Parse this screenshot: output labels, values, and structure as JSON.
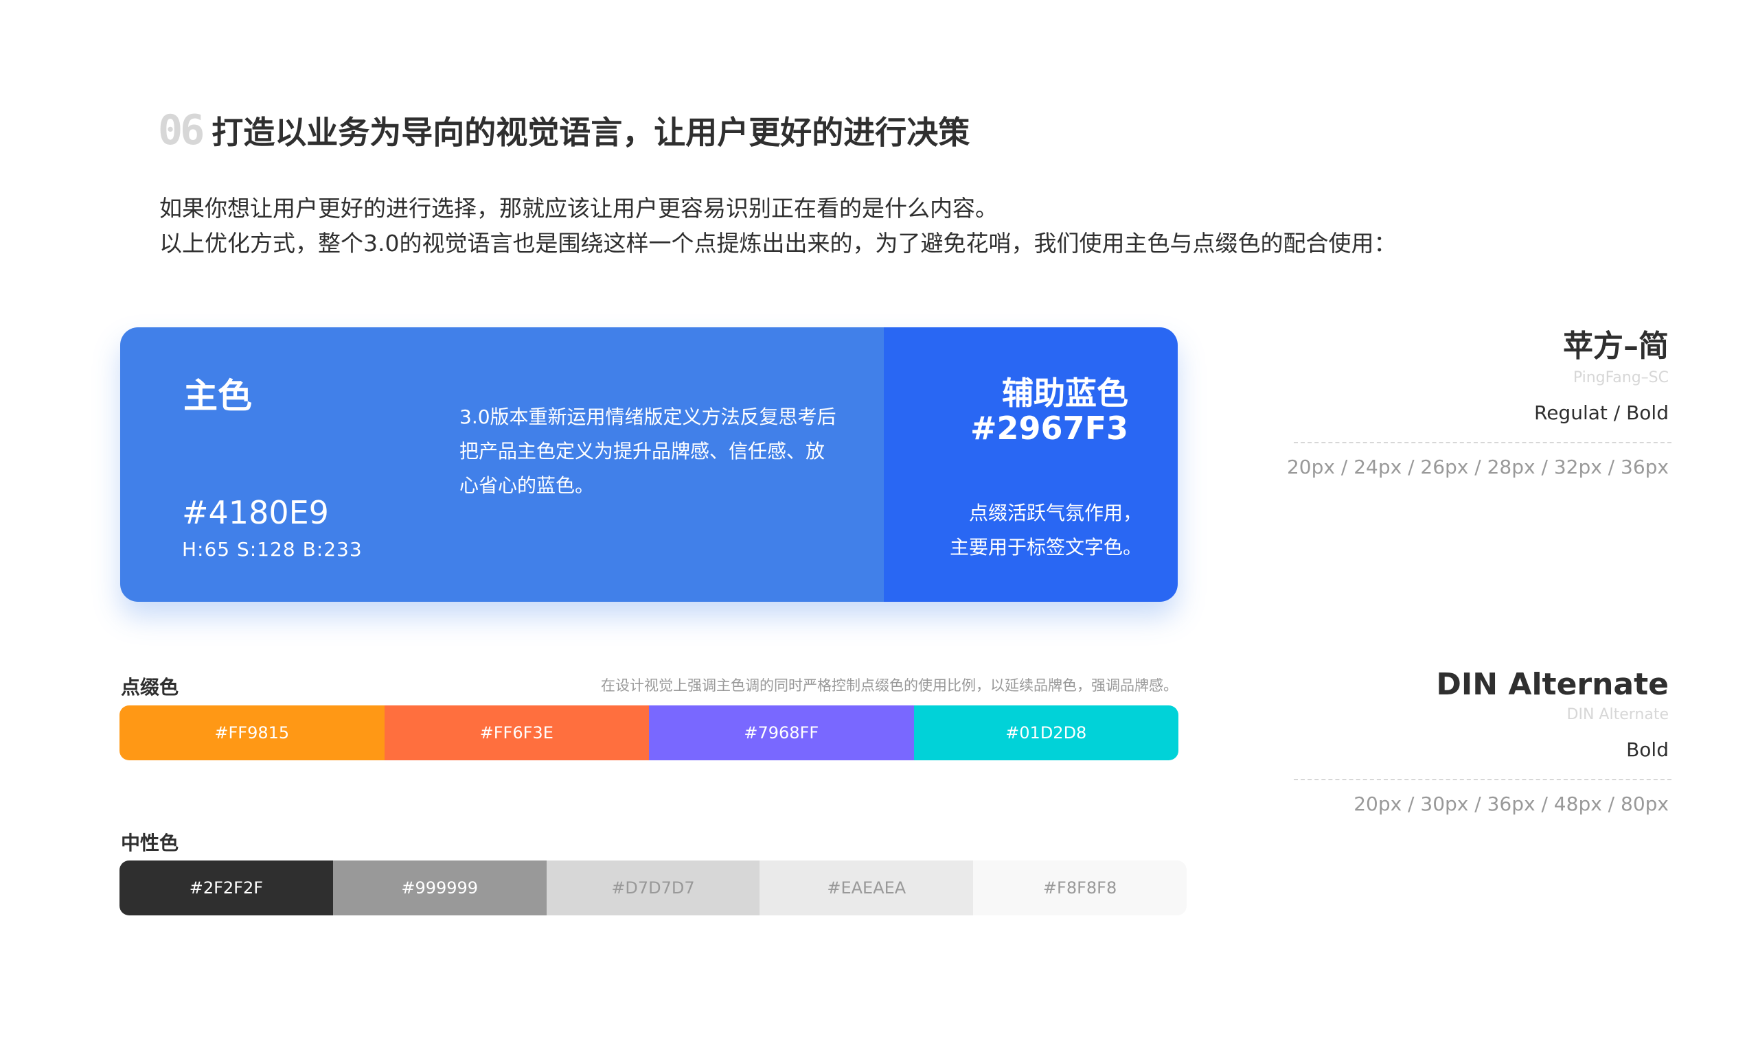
{
  "heading": {
    "number": "06",
    "title": "打造以业务为导向的视觉语言，让用户更好的进行决策"
  },
  "intro": {
    "line1": "如果你想让用户更好的进行选择，那就应该让用户更容易识别正在看的是什么内容。",
    "line2": "以上优化方式，整个3.0的视觉语言也是围绕这样一个点提炼出出来的，为了避免花哨，我们使用主色与点缀色的配合使用："
  },
  "primary": {
    "title": "主色",
    "desc_lines": [
      "3.0版本重新运用情绪版定义方法反复思考后",
      "把产品主色定义为提升品牌感、信任感、放",
      "心省心的蓝色。"
    ],
    "hex": "#4180E9",
    "hsb": "H:65  S:128  B:233",
    "color": "#4180E9"
  },
  "accent": {
    "title": "辅助蓝色",
    "hex": "#2967F3",
    "desc_lines": [
      "点缀活跃气氛作用，",
      "主要用于标签文字色。"
    ],
    "color": "#2967F3"
  },
  "accent_palette": {
    "label": "点缀色",
    "note": "在设计视觉上强调主色调的同时严格控制点缀色的使用比例，以延续品牌色，强调品牌感。",
    "swatches": [
      {
        "label": "#FF9815",
        "color": "#FF9815",
        "text_color": "#ffffff"
      },
      {
        "label": "#FF6F3E",
        "color": "#FF6F3E",
        "text_color": "#ffffff"
      },
      {
        "label": "#7968FF",
        "color": "#7968FF",
        "text_color": "#ffffff"
      },
      {
        "label": "#01D2D8",
        "color": "#01D2D8",
        "text_color": "#ffffff"
      }
    ]
  },
  "neutral_palette": {
    "label": "中性色",
    "swatches": [
      {
        "label": "#2F2F2F",
        "color": "#2F2F2F",
        "text_color": "#ffffff"
      },
      {
        "label": "#999999",
        "color": "#999999",
        "text_color": "#ffffff"
      },
      {
        "label": "#D7D7D7",
        "color": "#D7D7D7",
        "text_color": "#999999"
      },
      {
        "label": "#EAEAEA",
        "color": "#EAEAEA",
        "text_color": "#999999"
      },
      {
        "label": "#F8F8F8",
        "color": "#F8F8F8",
        "text_color": "#999999"
      }
    ]
  },
  "fonts": [
    {
      "name": "苹方–简",
      "sub": "PingFang–SC",
      "weights": "Regulat / Bold",
      "sizes": "20px / 24px / 26px / 28px / 32px / 36px"
    },
    {
      "name": "DIN Alternate",
      "sub": "DIN Alternate",
      "weights": "Bold",
      "sizes": "20px / 30px / 36px / 48px / 80px"
    }
  ]
}
